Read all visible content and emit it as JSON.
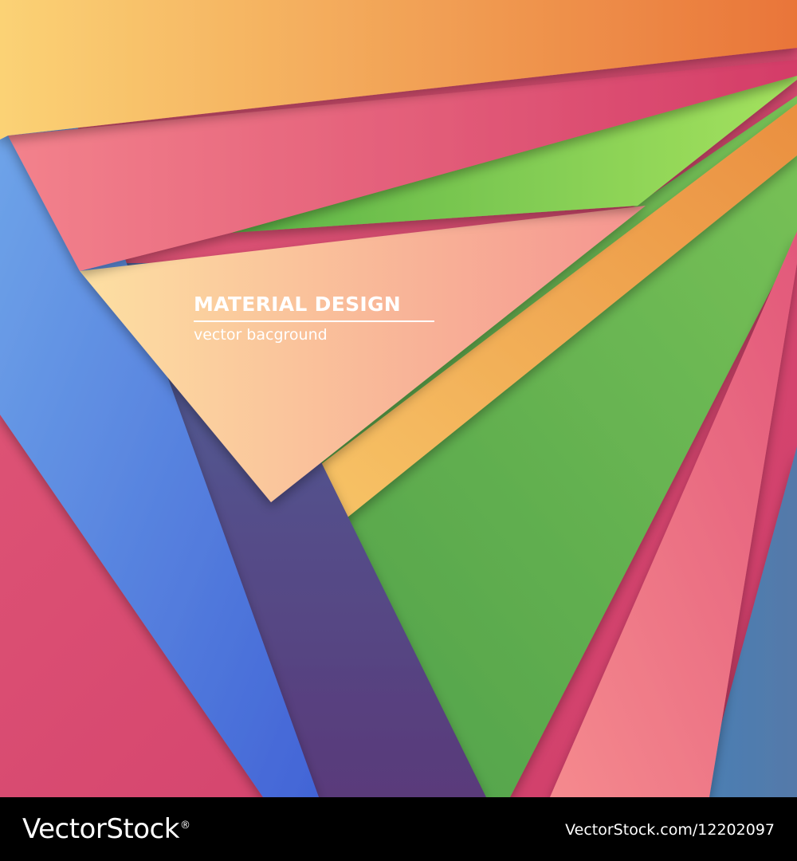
{
  "title": "MATERIAL DESIGN",
  "subtitle": "vector bacground",
  "footer": {
    "brand": "VectorStock",
    "registered_mark": "®",
    "image_id": "VectorStock.com/12202097"
  },
  "colors": {
    "orange_top": "#f0a04a",
    "pink": "#e05a7a",
    "green": "#62b34f",
    "peach": "#fbbf98",
    "blue": "#5b86de",
    "indigo": "#554b8e",
    "footer_bg": "#000000",
    "text": "#ffffff"
  }
}
